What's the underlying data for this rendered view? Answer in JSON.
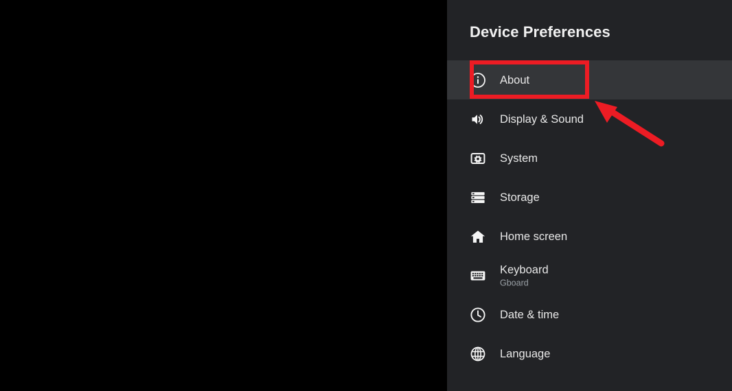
{
  "panel": {
    "title": "Device Preferences",
    "background_color": "#222326",
    "selected_row_color": "#343639",
    "backdrop_color": "#000000"
  },
  "menu": {
    "items": [
      {
        "label": "About",
        "subtitle": "",
        "icon": "info-circle-icon",
        "selected": true
      },
      {
        "label": "Display & Sound",
        "subtitle": "",
        "icon": "speaker-volume-icon",
        "selected": false
      },
      {
        "label": "System",
        "subtitle": "",
        "icon": "system-gear-box-icon",
        "selected": false
      },
      {
        "label": "Storage",
        "subtitle": "",
        "icon": "storage-bars-icon",
        "selected": false
      },
      {
        "label": "Home screen",
        "subtitle": "",
        "icon": "home-icon",
        "selected": false
      },
      {
        "label": "Keyboard",
        "subtitle": "Gboard",
        "icon": "keyboard-icon",
        "selected": false
      },
      {
        "label": "Date & time",
        "subtitle": "",
        "icon": "clock-icon",
        "selected": false
      },
      {
        "label": "Language",
        "subtitle": "",
        "icon": "globe-icon",
        "selected": false
      }
    ]
  },
  "annotations": {
    "highlight_color": "#ed1c24",
    "arrow_color": "#ed1c24",
    "highlight_target": "About",
    "arrow_points_to": "About"
  }
}
